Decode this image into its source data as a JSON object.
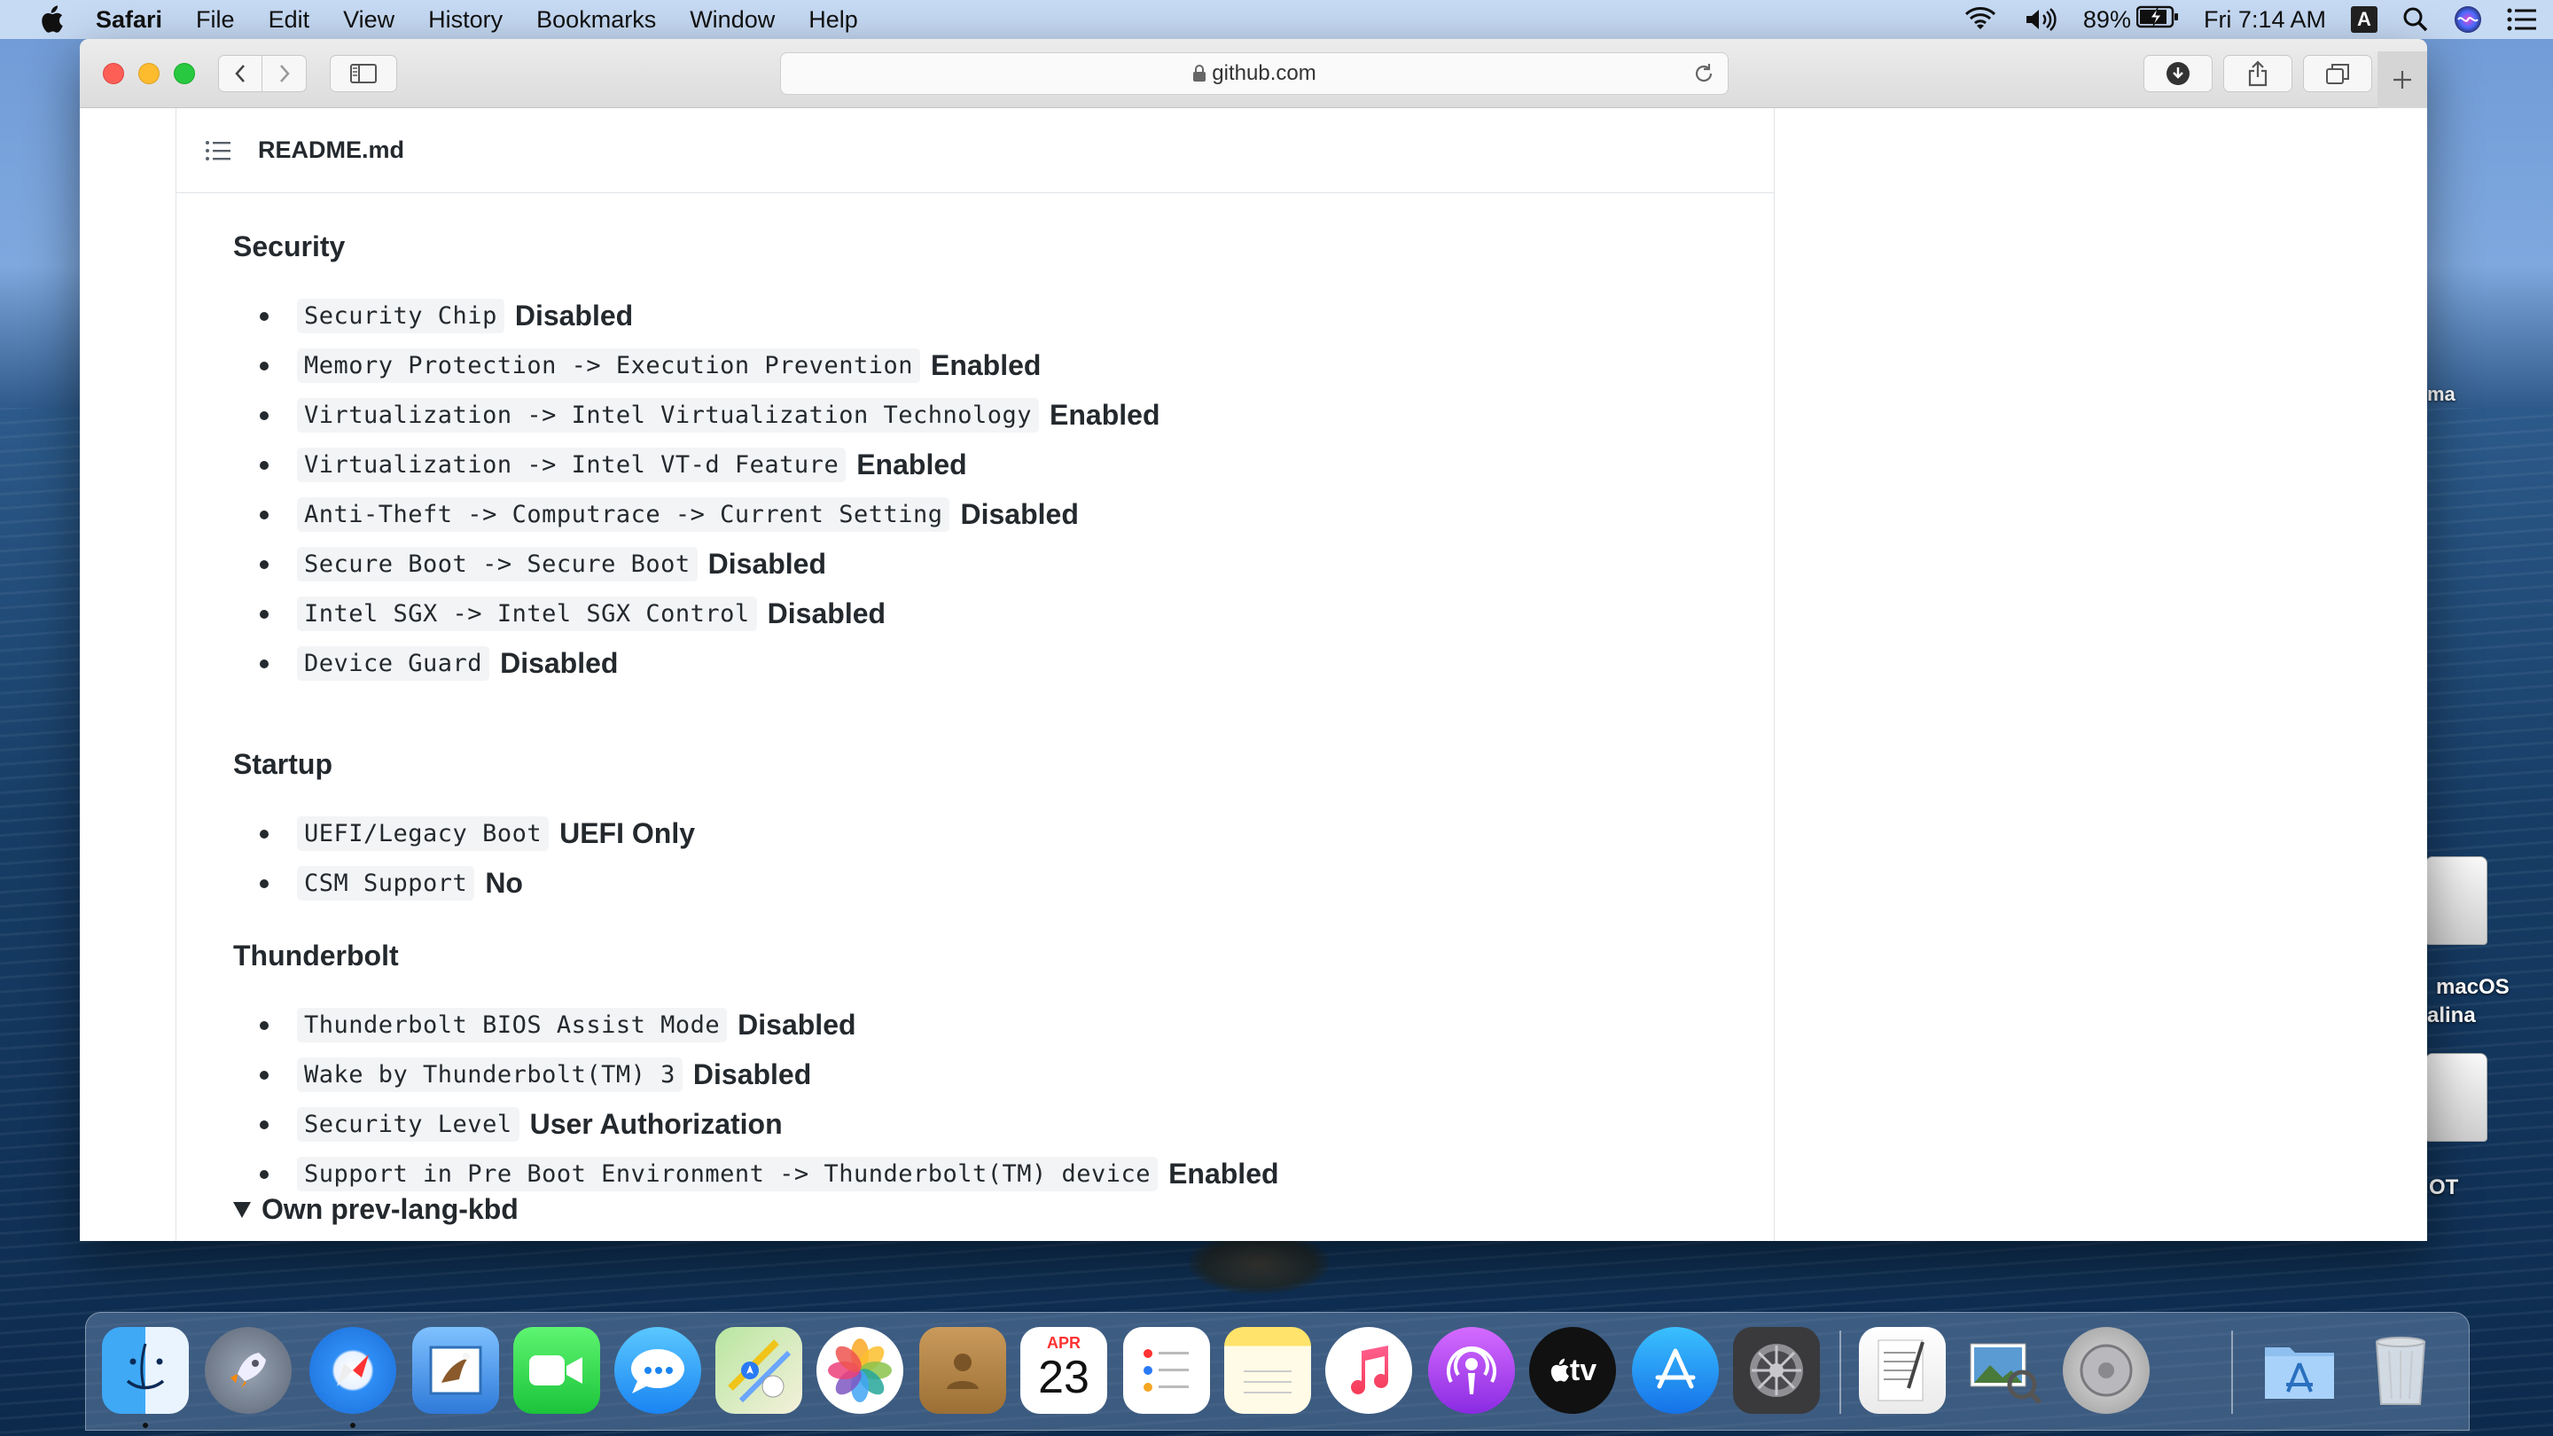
{
  "menubar": {
    "app": "Safari",
    "items": [
      "File",
      "Edit",
      "View",
      "History",
      "Bookmarks",
      "Window",
      "Help"
    ],
    "battery": "89%",
    "clock": "Fri 7:14 AM",
    "input_source": "A"
  },
  "browser": {
    "url": "github.com"
  },
  "readme": {
    "filename": "README.md",
    "sections": [
      {
        "title": "Security",
        "items": [
          {
            "code": "Security Chip",
            "value": "Disabled"
          },
          {
            "code": "Memory Protection -> Execution Prevention",
            "value": "Enabled"
          },
          {
            "code": "Virtualization -> Intel Virtualization Technology",
            "value": "Enabled"
          },
          {
            "code": "Virtualization -> Intel VT-d Feature",
            "value": "Enabled"
          },
          {
            "code": "Anti-Theft -> Computrace -> Current Setting",
            "value": "Disabled"
          },
          {
            "code": "Secure Boot -> Secure Boot",
            "value": "Disabled"
          },
          {
            "code": "Intel SGX -> Intel SGX Control",
            "value": "Disabled"
          },
          {
            "code": "Device Guard",
            "value": "Disabled"
          }
        ]
      },
      {
        "title": "Startup",
        "items": [
          {
            "code": "UEFI/Legacy Boot",
            "value": "UEFI Only"
          },
          {
            "code": "CSM Support",
            "value": "No"
          }
        ]
      },
      {
        "title": "Thunderbolt",
        "items": [
          {
            "code": "Thunderbolt BIOS Assist Mode",
            "value": "Disabled"
          },
          {
            "code": "Wake by Thunderbolt(TM) 3",
            "value": "Disabled"
          },
          {
            "code": "Security Level",
            "value": "User Authorization"
          },
          {
            "code": "Support in Pre Boot Environment -> Thunderbolt(TM) device",
            "value": "Enabled"
          }
        ]
      }
    ],
    "collapsed_summary": "Own prev-lang-kbd"
  },
  "desktop": {
    "labels": [
      "ma",
      "macOS",
      "alina",
      "OT"
    ]
  },
  "dock": {
    "calendar_month": "APR",
    "calendar_day": "23",
    "tv_label": "tv",
    "icons": [
      "finder-icon",
      "launchpad-icon",
      "safari-icon",
      "mail-icon",
      "facetime-icon",
      "messages-icon",
      "maps-icon",
      "photos-icon",
      "contacts-icon",
      "calendar-icon",
      "reminders-icon",
      "notes-icon",
      "music-icon",
      "podcasts-icon",
      "apple-tv-icon",
      "app-store-icon",
      "system-preferences-icon",
      "textedit-icon",
      "preview-icon",
      "disk-utility-icon",
      "applications-folder-icon",
      "trash-icon"
    ]
  },
  "colors": {
    "close": "#fd5f57",
    "minimize": "#fdbb2e",
    "zoom": "#28c840",
    "code_bg": "#f3f4f6",
    "text": "#24292e"
  }
}
